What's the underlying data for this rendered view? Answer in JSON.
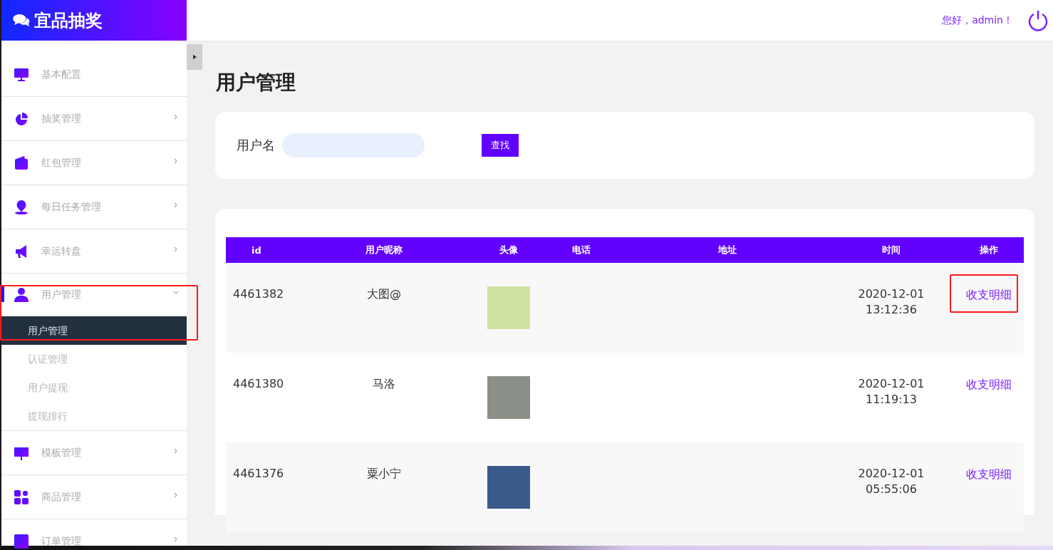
{
  "brand": {
    "title": "宜品抽奖"
  },
  "header": {
    "greeting": "您好，admin！"
  },
  "sidebar": {
    "items": [
      {
        "label": "基本配置",
        "kind": "link",
        "active": false,
        "annotated": false
      },
      {
        "label": "抽奖管理",
        "kind": "menu",
        "active": false,
        "expanded": false,
        "annotated": false
      },
      {
        "label": "红包管理",
        "kind": "menu",
        "active": false,
        "expanded": false,
        "annotated": false
      },
      {
        "label": "每日任务管理",
        "kind": "menu",
        "active": false,
        "expanded": false,
        "annotated": false
      },
      {
        "label": "幸运转盘",
        "kind": "menu",
        "active": false,
        "expanded": false,
        "annotated": false
      },
      {
        "label": "用户管理",
        "kind": "menu",
        "active": true,
        "expanded": true,
        "annotated": true,
        "children": [
          {
            "label": "用户管理",
            "selected": true
          },
          {
            "label": "认证管理",
            "selected": false
          },
          {
            "label": "用户提现",
            "selected": false
          },
          {
            "label": "提现排行",
            "selected": false
          }
        ]
      },
      {
        "label": "模板管理",
        "kind": "menu",
        "active": false,
        "expanded": false,
        "annotated": false
      },
      {
        "label": "商品管理",
        "kind": "menu",
        "active": false,
        "expanded": false,
        "annotated": false
      },
      {
        "label": "订单管理",
        "kind": "menu",
        "active": false,
        "expanded": false,
        "annotated": false
      }
    ]
  },
  "page": {
    "title": "用户管理"
  },
  "search": {
    "label": "用户名",
    "button": "查找"
  },
  "table": {
    "columns": [
      "id",
      "用户昵称",
      "头像",
      "电话",
      "地址",
      "时间",
      "操作"
    ],
    "rows": [
      {
        "id": "4461382",
        "nickname": "大图@",
        "date": "2020-12-01",
        "time": "13:12:36",
        "action": "收支明细",
        "annotated": true
      },
      {
        "id": "4461380",
        "nickname": "马洛",
        "date": "2020-12-01",
        "time": "11:19:13",
        "action": "收支明细",
        "annotated": false
      },
      {
        "id": "4461376",
        "nickname": "粟小宁",
        "date": "2020-12-01",
        "time": "05:55:06",
        "action": "收支明细",
        "annotated": false
      }
    ]
  }
}
